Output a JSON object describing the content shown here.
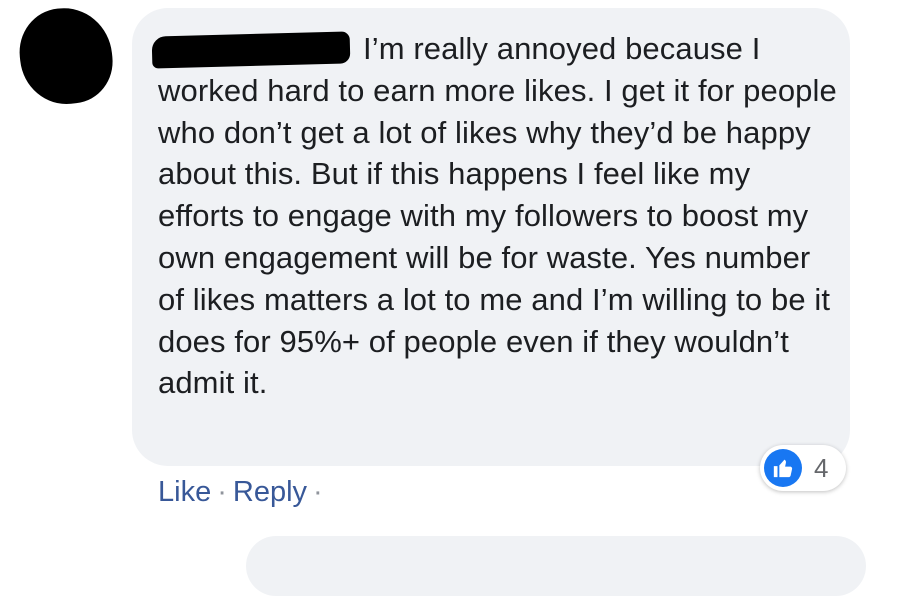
{
  "comment": {
    "text": "I’m really annoyed because I worked hard to earn more likes. I get it for people who don’t get a lot of likes why they’d be happy about this. But if this happens I feel like my efforts to engage with my followers to boost my own engagement will be for waste. Yes number of likes matters a lot to me and I’m willing to be it does for 95%+ of people even if they wouldn’t admit it.",
    "reaction_icon": "thumbs-up-icon",
    "reaction_count": "4"
  },
  "actions": {
    "like_label": "Like",
    "separator": "·",
    "reply_label": "Reply"
  },
  "colors": {
    "bubble": "#f0f2f5",
    "text": "#1c1e21",
    "link": "#385898",
    "like_blue": "#1877f2"
  }
}
